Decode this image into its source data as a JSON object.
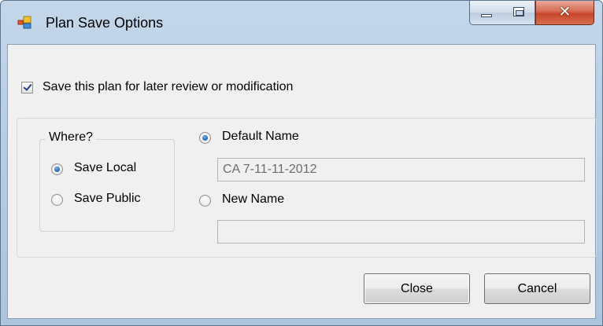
{
  "window": {
    "title": "Plan Save Options",
    "icon": "app-window-icon",
    "controls": [
      "minimize-icon",
      "maximize-icon",
      "close-icon"
    ]
  },
  "save_checkbox": {
    "label": "Save this plan for later review or modification",
    "checked": true
  },
  "where_group": {
    "title": "Where?",
    "options": [
      {
        "label": "Save Local",
        "checked": true
      },
      {
        "label": "Save Public",
        "checked": false
      }
    ]
  },
  "name_group": {
    "default_label": "Default Name",
    "default_checked": true,
    "default_value": "CA 7-11-11-2012",
    "new_label": "New Name",
    "new_checked": false,
    "new_value": ""
  },
  "buttons": {
    "close": "Close",
    "cancel": "Cancel"
  },
  "colors": {
    "titlebar": "#b9cde3",
    "client_bg": "#f0f0f0",
    "close_button": "#c7452b",
    "radio_dot": "#1d5fb1"
  }
}
